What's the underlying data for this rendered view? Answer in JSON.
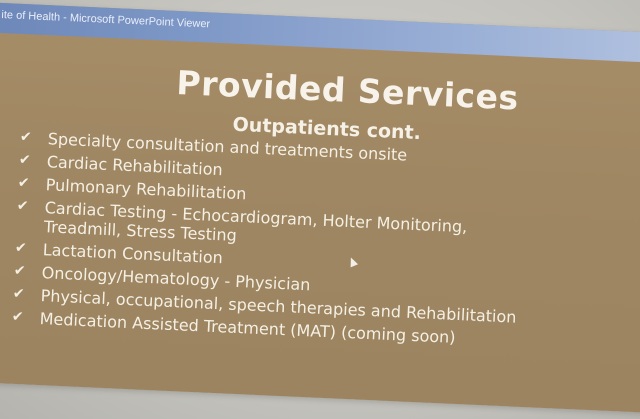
{
  "window": {
    "title": "ite of Health - Microsoft PowerPoint Viewer"
  },
  "slide": {
    "title": "Provided Services",
    "subtitle": "Outpatients cont.",
    "check_glyph": "✔",
    "bullets": [
      {
        "text": "Specialty consultation and treatments onsite"
      },
      {
        "text": "Cardiac Rehabilitation"
      },
      {
        "text": "Pulmonary Rehabilitation"
      },
      {
        "text": "Cardiac Testing  - Echocardiogram, Holter Monitoring,",
        "text2": "Treadmill, Stress Testing"
      },
      {
        "text": "Lactation Consultation"
      },
      {
        "text": "Oncology/Hematology  - Physician"
      },
      {
        "text": "Physical, occupational, speech therapies and Rehabilitation"
      },
      {
        "text": "Medication Assisted Treatment (MAT) (coming soon)"
      }
    ]
  },
  "colors": {
    "slide_background": "#a08763",
    "text": "#f4f0e4",
    "titlebar": "#7d97c6"
  }
}
